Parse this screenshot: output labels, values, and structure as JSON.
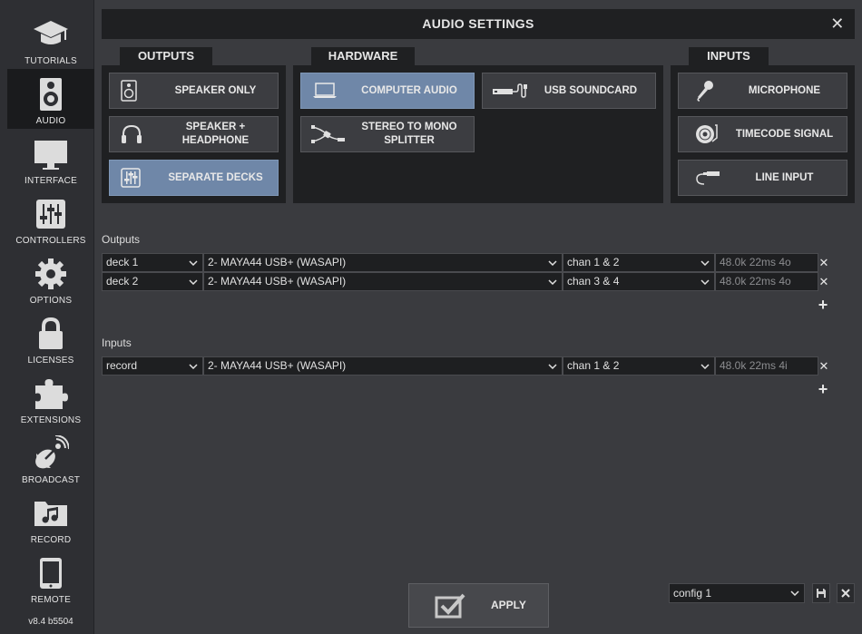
{
  "sidebar": {
    "items": [
      {
        "label": "TUTORIALS",
        "icon": "graduation-cap-icon"
      },
      {
        "label": "AUDIO",
        "icon": "speaker-icon"
      },
      {
        "label": "INTERFACE",
        "icon": "monitor-icon"
      },
      {
        "label": "CONTROLLERS",
        "icon": "sliders-icon"
      },
      {
        "label": "OPTIONS",
        "icon": "gear-icon"
      },
      {
        "label": "LICENSES",
        "icon": "lock-icon"
      },
      {
        "label": "EXTENSIONS",
        "icon": "puzzle-icon"
      },
      {
        "label": "BROADCAST",
        "icon": "satellite-dish-icon"
      },
      {
        "label": "RECORD",
        "icon": "music-folder-icon"
      },
      {
        "label": "REMOTE",
        "icon": "tablet-icon"
      }
    ],
    "active": "AUDIO",
    "version": "v8.4 b5504"
  },
  "window": {
    "title": "AUDIO SETTINGS",
    "close": "✕"
  },
  "tabs": {
    "outputs": "OUTPUTS",
    "hardware": "HARDWARE",
    "inputs": "INPUTS"
  },
  "outputs_options": [
    {
      "label": "SPEAKER ONLY",
      "icon": "speaker-icon",
      "selected": false
    },
    {
      "label": "SPEAKER + HEADPHONE",
      "icon": "headphone-icon",
      "selected": false
    },
    {
      "label": "SEPARATE DECKS",
      "icon": "mixer-icon",
      "selected": true
    }
  ],
  "hardware_options": [
    {
      "label": "COMPUTER AUDIO",
      "icon": "laptop-icon",
      "selected": true
    },
    {
      "label": "USB SOUNDCARD",
      "icon": "usb-soundcard-icon",
      "selected": false
    },
    {
      "label": "STEREO TO MONO SPLITTER",
      "icon": "splitter-cable-icon",
      "selected": false
    }
  ],
  "inputs_options": [
    {
      "label": "MICROPHONE",
      "icon": "microphone-icon",
      "selected": false
    },
    {
      "label": "TIMECODE SIGNAL",
      "icon": "vinyl-icon",
      "selected": false
    },
    {
      "label": "LINE INPUT",
      "icon": "line-cable-icon",
      "selected": false
    }
  ],
  "outputs_section": {
    "label": "Outputs",
    "rows": [
      {
        "target": "deck 1",
        "device": "2- MAYA44 USB+ (WASAPI)",
        "channels": "chan 1 & 2",
        "info": "48.0k 22ms 4o"
      },
      {
        "target": "deck 2",
        "device": "2- MAYA44 USB+ (WASAPI)",
        "channels": "chan 3 & 4",
        "info": "48.0k 22ms 4o"
      }
    ]
  },
  "inputs_section": {
    "label": "Inputs",
    "rows": [
      {
        "target": "record",
        "device": "2- MAYA44 USB+ (WASAPI)",
        "channels": "chan 1 & 2",
        "info": "48.0k 22ms 4i"
      }
    ]
  },
  "footer": {
    "apply": "APPLY",
    "config": "config 1"
  },
  "colors": {
    "background": "#3a3b3f",
    "panel": "#1f2022",
    "selected": "#6f87a8",
    "button": "#3c3d41"
  }
}
